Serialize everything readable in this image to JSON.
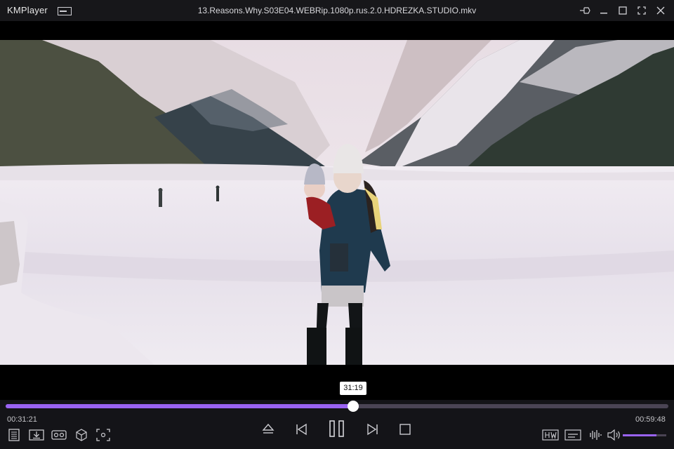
{
  "app": {
    "name": "KMPlayer"
  },
  "window": {
    "file_title": "13.Reasons.Why.S03E04.WEBRip.1080p.rus.2.0.HDREZKA.STUDIO.mkv"
  },
  "playback": {
    "current_time": "00:31:21",
    "total_time": "00:59:48",
    "tooltip_time": "31:19",
    "progress": 0.524,
    "volume": 0.78
  },
  "colors": {
    "accent": "#9a63f2",
    "titlebar": "#17171a",
    "controlbar": "#141418"
  },
  "icons": {
    "left": [
      "playlist-icon",
      "download-icon",
      "vr-icon",
      "3d-cube-icon",
      "screen-capture-icon"
    ],
    "center": [
      "eject-icon",
      "previous-icon",
      "pause-icon",
      "next-icon",
      "stop-icon"
    ],
    "right": [
      "hw-decoder-icon",
      "subtitle-icon",
      "audio-waveform-icon",
      "volume-icon"
    ]
  }
}
